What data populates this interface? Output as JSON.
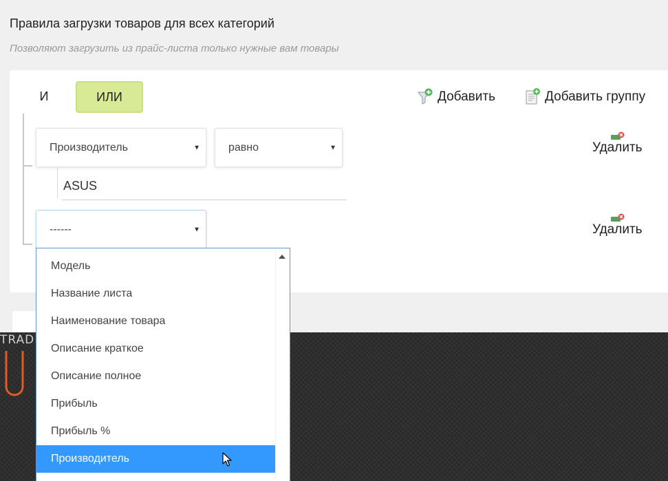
{
  "header": {
    "title": "Правила загрузки товаров для всех категорий",
    "subtitle": "Позволяют загрузить из прайс-листа только нужные вам товары"
  },
  "logic": {
    "and_label": "И",
    "or_label": "ИЛИ",
    "active": "ИЛИ"
  },
  "toolbar": {
    "add_label": "Добавить",
    "add_group_label": "Добавить группу"
  },
  "rules": [
    {
      "field": "Производитель",
      "operator": "равно",
      "value": "ASUS",
      "delete_label": "Удалить"
    },
    {
      "field": "------",
      "delete_label": "Удалить"
    }
  ],
  "dropdown": {
    "options": [
      "Модель",
      "Название листа",
      "Наименование товара",
      "Описание краткое",
      "Описание полное",
      "Прибыль",
      "Прибыль %",
      "Производитель"
    ],
    "highlighted": "Производитель"
  },
  "branding": {
    "logo_text": "TRADE"
  },
  "colors": {
    "active_logic_bg": "#d8ea95",
    "highlight": "#3399ff",
    "banner_bg": "#2e2e2e",
    "logo_accent": "#e05a2a"
  }
}
